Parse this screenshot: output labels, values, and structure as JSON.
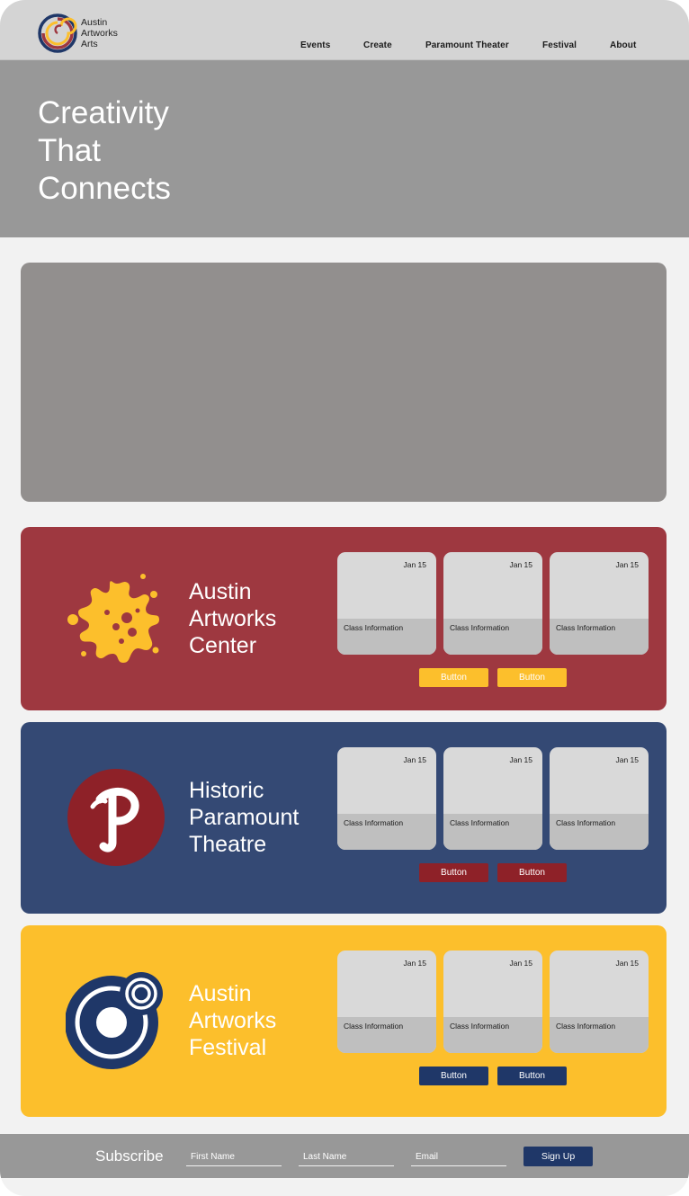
{
  "brand": {
    "name_lines": [
      "Austin",
      "Artworks",
      "Arts"
    ],
    "logo_icon": "swirl-logo-icon"
  },
  "nav": {
    "items": [
      "Events",
      "Create",
      "Paramount Theater",
      "Festival",
      "About"
    ]
  },
  "hero": {
    "title_lines": [
      "Creativity",
      "That",
      "Connects"
    ]
  },
  "colors": {
    "header_bg": "#d4d4d4",
    "hero_bg": "#989898",
    "banner_bg": "#928f8e",
    "center_bg": "#9e3840",
    "paramount_bg": "#344974",
    "festival_bg": "#fcbf2c",
    "accent_yellow": "#fcbf2c",
    "accent_red": "#8e2128",
    "accent_navy": "#1f3768"
  },
  "venues": [
    {
      "name_lines": [
        "Austin",
        "Artworks",
        "Center"
      ],
      "logo_icon": "paint-splatter-icon",
      "cards": [
        {
          "date": "Jan 15",
          "info": "Class Information"
        },
        {
          "date": "Jan 15",
          "info": "Class Information"
        },
        {
          "date": "Jan 15",
          "info": "Class Information"
        }
      ],
      "buttons": [
        "Button",
        "Button"
      ]
    },
    {
      "name_lines": [
        "Historic",
        "Paramount",
        "Theatre"
      ],
      "logo_icon": "paramount-p-icon",
      "cards": [
        {
          "date": "Jan 15",
          "info": "Class Information"
        },
        {
          "date": "Jan 15",
          "info": "Class Information"
        },
        {
          "date": "Jan 15",
          "info": "Class Information"
        }
      ],
      "buttons": [
        "Button",
        "Button"
      ]
    },
    {
      "name_lines": [
        "Austin",
        "Artworks",
        "Festival"
      ],
      "logo_icon": "festival-circles-icon",
      "cards": [
        {
          "date": "Jan 15",
          "info": "Class Information"
        },
        {
          "date": "Jan 15",
          "info": "Class Information"
        },
        {
          "date": "Jan 15",
          "info": "Class Information"
        }
      ],
      "buttons": [
        "Button",
        "Button"
      ]
    }
  ],
  "subscribe": {
    "title": "Subscribe",
    "first_name_placeholder": "First Name",
    "last_name_placeholder": "Last Name",
    "email_placeholder": "Email",
    "submit_label": "Sign Up"
  }
}
